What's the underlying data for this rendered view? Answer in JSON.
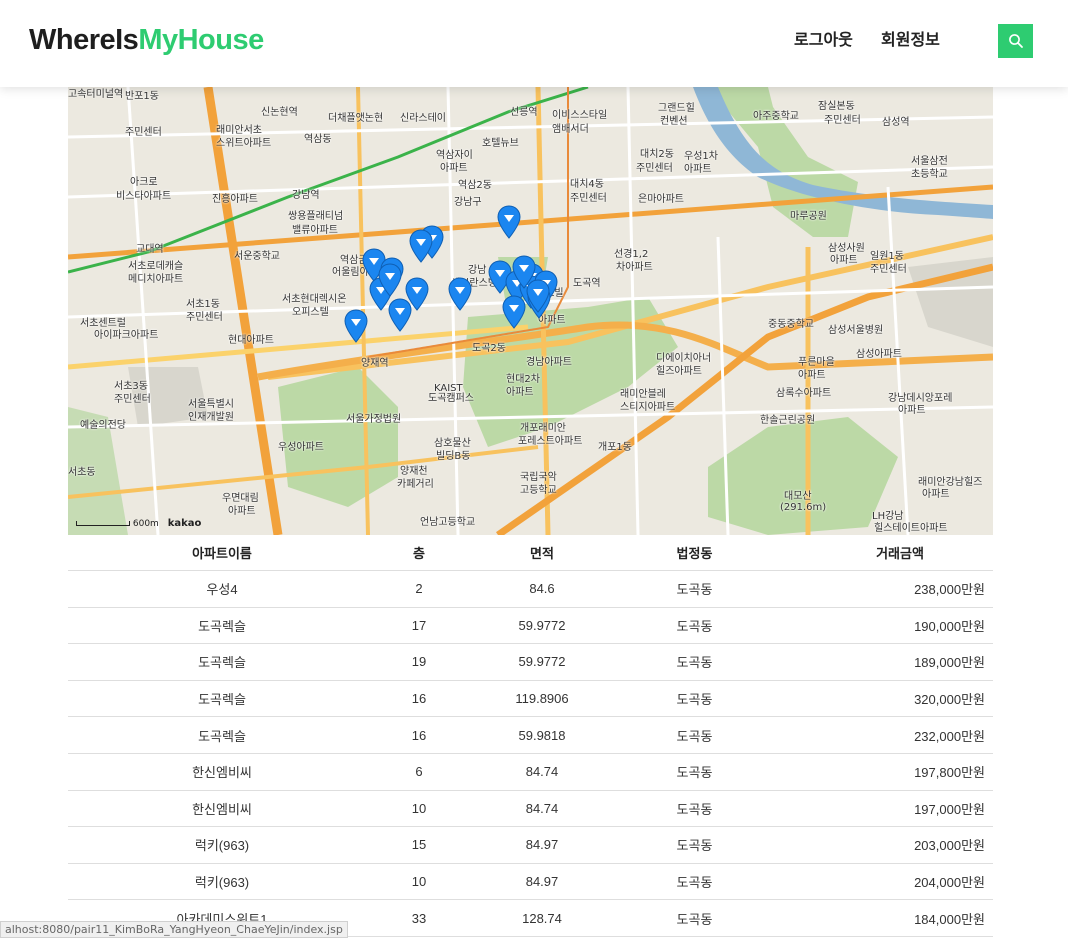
{
  "header": {
    "logo_part1": "WhereIs",
    "logo_part2": "MyHouse",
    "nav": [
      "로그아웃",
      "회원정보"
    ],
    "search_icon": "search-icon",
    "brand_color": "#2ecc71"
  },
  "map": {
    "labels": [
      "고속터미널역",
      "반포1동",
      "주민센터",
      "신논현역",
      "더채플앳논현",
      "신라스테이",
      "선릉역",
      "이비스스타일",
      "앰배서더",
      "그랜드힐",
      "컨벤션",
      "잠실본동",
      "주민센터",
      "래미안서초",
      "스위트아파트",
      "역삼동",
      "역삼자이",
      "아파트",
      "호텔뉴브",
      "대치2동",
      "주민센터",
      "우성1차",
      "아파트",
      "아주중학교",
      "삼성역",
      "아크로",
      "비스타아파트",
      "진흥아파트",
      "강남역",
      "역삼2동",
      "대치4동",
      "주민센터",
      "은마아파트",
      "서울삼전",
      "초등학교",
      "쌍용플래티넘",
      "밸류아파트",
      "강남구",
      "마루공원",
      "교대역",
      "서운중학교",
      "역삼금호",
      "어울림아파트",
      "삼성사원",
      "아파트",
      "선경1,2",
      "차아파트",
      "서초로데캐슬",
      "메디치아파트",
      "강남",
      "세브란스병원",
      "일원1동",
      "주민센터",
      "서초1동",
      "주민센터",
      "서초현대렉시온",
      "오피스텔",
      "도곡역",
      "쉐르빌",
      "아파트",
      "서초센트럴",
      "아이파크아파트",
      "현대아파트",
      "도곡2동",
      "중동중학교",
      "삼성서울병원",
      "양재역",
      "삼성아파트",
      "경남아파트",
      "디에이치아너",
      "힐즈아파트",
      "서초3동",
      "주민센터",
      "현대2차",
      "아파트",
      "푸른마을",
      "아파트",
      "서울특별시",
      "인재개발원",
      "KAIST",
      "도곡캠퍼스",
      "래미안블레",
      "스티지아파트",
      "삼록수아파트",
      "서울가정법원",
      "개포래미안",
      "포레스트아파트",
      "한솔근린공원",
      "강남데시앙포레",
      "아파트",
      "예술의전당",
      "우성아파트",
      "삼호물산",
      "빌딩B동",
      "개포1동",
      "서초동",
      "양재천",
      "카페거리",
      "국립국악",
      "고등학교",
      "대모산",
      "(291.6m)",
      "래미안강남힐즈",
      "아파트",
      "우면대림",
      "아파트",
      "언남고등학교",
      "LH강남",
      "힐스테이트아파트"
    ],
    "scale_text": "600m",
    "attribution": "kakao",
    "marker_color": "#1b86f0",
    "marker_count": 20
  },
  "table": {
    "headers": [
      "아파트이름",
      "층",
      "면적",
      "법정동",
      "거래금액"
    ],
    "rows": [
      [
        "우성4",
        "2",
        "84.6",
        "도곡동",
        "238,000만원"
      ],
      [
        "도곡렉슬",
        "17",
        "59.9772",
        "도곡동",
        "190,000만원"
      ],
      [
        "도곡렉슬",
        "19",
        "59.9772",
        "도곡동",
        "189,000만원"
      ],
      [
        "도곡렉슬",
        "16",
        "119.8906",
        "도곡동",
        "320,000만원"
      ],
      [
        "도곡렉슬",
        "16",
        "59.9818",
        "도곡동",
        "232,000만원"
      ],
      [
        "한신엠비씨",
        "6",
        "84.74",
        "도곡동",
        "197,800만원"
      ],
      [
        "한신엠비씨",
        "10",
        "84.74",
        "도곡동",
        "197,000만원"
      ],
      [
        "럭키(963)",
        "15",
        "84.97",
        "도곡동",
        "203,000만원"
      ],
      [
        "럭키(963)",
        "10",
        "84.97",
        "도곡동",
        "204,000만원"
      ],
      [
        "아카데미스위트1",
        "33",
        "128.74",
        "도곡동",
        "184,000만원"
      ]
    ]
  },
  "status_bar": "alhost:8080/pair11_KimBoRa_YangHyeon_ChaeYeJin/index.jsp"
}
